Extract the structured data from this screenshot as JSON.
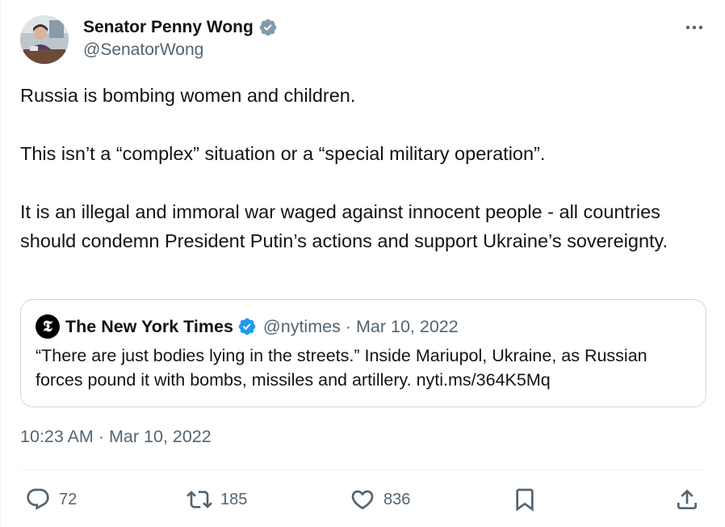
{
  "author": {
    "name": "Senator Penny Wong",
    "handle": "@SenatorWong",
    "verified_color": "#829aab"
  },
  "tweet": {
    "paragraphs": [
      "Russia is bombing women and children.",
      "This isn’t a “complex” situation or a “special military operation”.",
      "It is an illegal and immoral war waged against innocent people - all countries should condemn President Putin’s actions and support Ukraine’s sovereignty."
    ],
    "time": "10:23 AM",
    "date": "Mar 10, 2022",
    "separator": "·"
  },
  "quote": {
    "logo_letter": "𝕿",
    "name": "The New York Times",
    "handle": "@nytimes",
    "separator": "·",
    "date": "Mar 10, 2022",
    "text": "“There are just bodies lying in the streets.” Inside Mariupol, Ukraine, as Russian forces pound it with bombs, missiles and artillery. nyti.ms/364K5Mq",
    "verified_color": "#1d9bf0"
  },
  "actions": {
    "reply_count": "72",
    "retweet_count": "185",
    "like_count": "836"
  },
  "icons": {
    "more": "more-dots-icon",
    "reply": "reply-bubble-icon",
    "retweet": "retweet-icon",
    "like": "heart-icon",
    "bookmark": "bookmark-icon",
    "share": "share-icon"
  },
  "colors": {
    "text": "#0f1419",
    "secondary": "#536471",
    "border": "#cfd9de"
  }
}
